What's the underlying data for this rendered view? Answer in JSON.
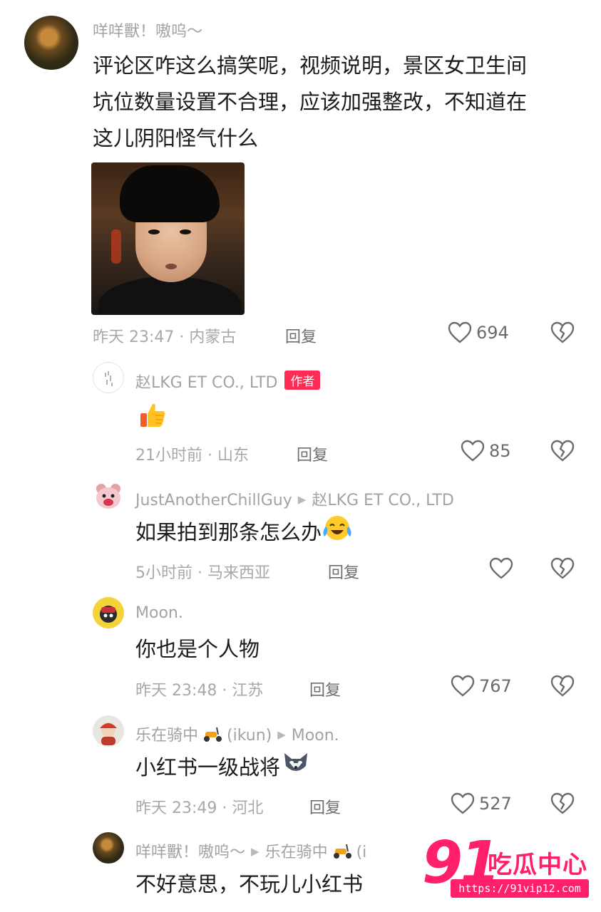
{
  "comments": [
    {
      "author": "咩咩獸！嗷呜～",
      "lines": [
        "评论区咋这么搞笑呢，视频说明，景区女卫生间",
        "坑位数量设置不合理，应该加强整改，不知道在",
        "这儿阴阳怪气什么"
      ],
      "meta": "昨天 23:47 · 内蒙古",
      "reply_label": "回复",
      "likes": "694"
    },
    {
      "author": "赵LKG ET CO., LTD",
      "badge": "作者",
      "text_emoji": "thumbs-up",
      "meta": "21小时前 · 山东",
      "reply_label": "回复",
      "likes": "85"
    },
    {
      "author": "JustAnotherChillGuy",
      "reply_to": "赵LKG ET CO., LTD",
      "text": "如果拍到那条怎么办",
      "meta": "5小时前 · 马来西亚",
      "reply_label": "回复",
      "likes": ""
    },
    {
      "author": "Moon.",
      "text": "你也是个人物",
      "meta": "昨天 23:48 · 江苏",
      "reply_label": "回复",
      "likes": "767"
    },
    {
      "author_part1": "乐在骑中",
      "author_part2": "(ikun)",
      "reply_to": "Moon.",
      "text": "小红书一级战将",
      "meta": "昨天 23:49 · 河北",
      "reply_label": "回复",
      "likes": "527"
    },
    {
      "author": "咩咩獸！嗷呜～",
      "reply_to": "乐在骑中",
      "reply_to_suffix": "(i",
      "text": "不好意思，不玩儿小红书"
    }
  ],
  "watermark": {
    "number": "91",
    "text": "吃瓜中心",
    "url": "https://91vip12.com"
  },
  "icons": {
    "like": "heart-outline-icon",
    "dislike": "broken-heart-icon",
    "author_badge_color": "#fe2c55",
    "watermark_color": "#ff1f6d"
  }
}
